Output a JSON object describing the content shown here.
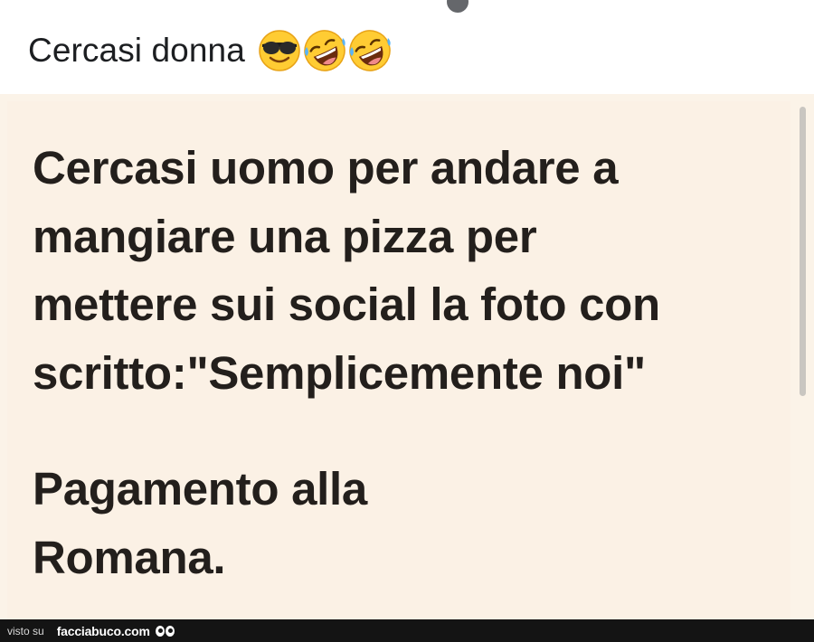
{
  "post": {
    "caption": "Cercasi donna",
    "caption_emojis": [
      "smiling-face-with-sunglasses",
      "rolling-on-the-floor-laughing",
      "rolling-on-the-floor-laughing"
    ]
  },
  "image_card": {
    "lines": [
      "Cercasi uomo per andare a",
      "mangiare una pizza per",
      "mettere sui social la foto con",
      "scritto:\"Semplicemente noi\""
    ],
    "lines_second": [
      "Pagamento alla",
      "Romana."
    ],
    "background_color": "#fbf1e5",
    "text_color": "#231f1c"
  },
  "watermark": {
    "prefix": "visto su",
    "site": "facciabuco.com"
  }
}
